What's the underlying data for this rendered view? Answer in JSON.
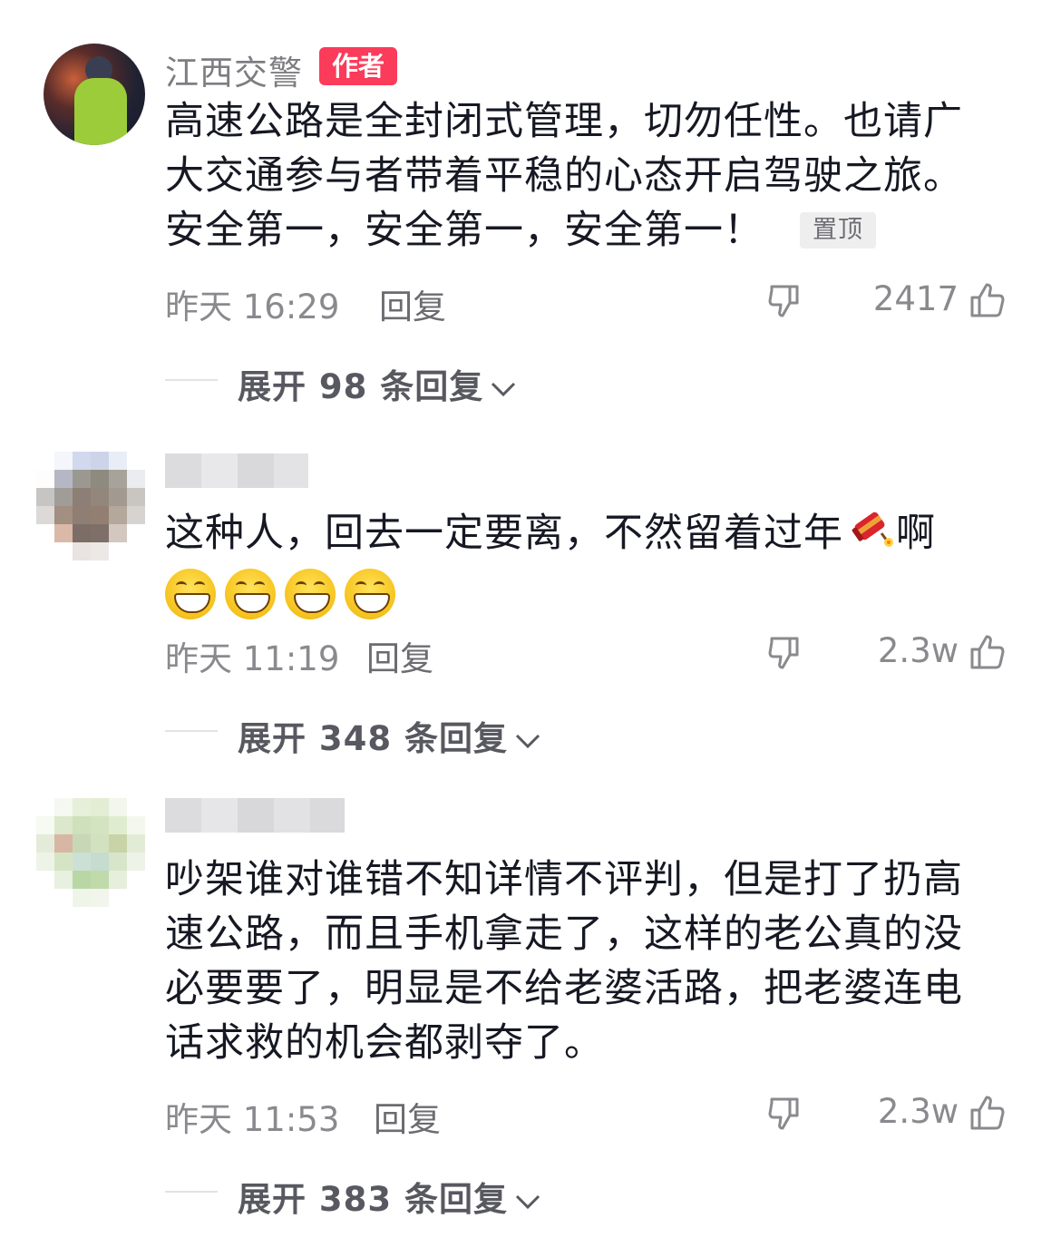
{
  "comments": [
    {
      "username": "江西交警",
      "author_badge": "作者",
      "text": "高速公路是全封闭式管理，切勿任性。也请广大交通参与者带着平稳的心态开启驾驶之旅。安全第一，安全第一，安全第一！",
      "lines": [
        "高速公路是全封闭式管理，切勿任性。也请广",
        "大交通参与者带着平稳的心态开启驾驶之旅。",
        "安全第一，安全第一，安全第一！"
      ],
      "pinned_label": "置顶",
      "time": "昨天 16:29",
      "reply_label": "回复",
      "likes": "2417",
      "expand_label": "展开 98 条回复"
    },
    {
      "username": "",
      "text_before_emoji": "这种人，回去一定要离，不然留着过年",
      "text_after_emoji": "啊",
      "emojis": [
        "grin-icon",
        "grin-icon",
        "grin-icon",
        "grin-icon"
      ],
      "time": "昨天 11:19",
      "reply_label": "回复",
      "likes": "2.3w",
      "expand_label": "展开 348 条回复"
    },
    {
      "username": "",
      "lines": [
        "吵架谁对谁错不知详情不评判，但是打了扔高",
        "速公路，而且手机拿走了，这样的老公真的没",
        "必要要了，明显是不给老婆活路，把老婆连电",
        "话求救的机会都剥夺了。"
      ],
      "time": "昨天 11:53",
      "reply_label": "回复",
      "likes": "2.3w",
      "expand_label": "展开 383 条回复"
    }
  ],
  "colors": {
    "author_badge": "#fb3b5a",
    "text": "#161823",
    "meta": "#8a8a8e"
  }
}
